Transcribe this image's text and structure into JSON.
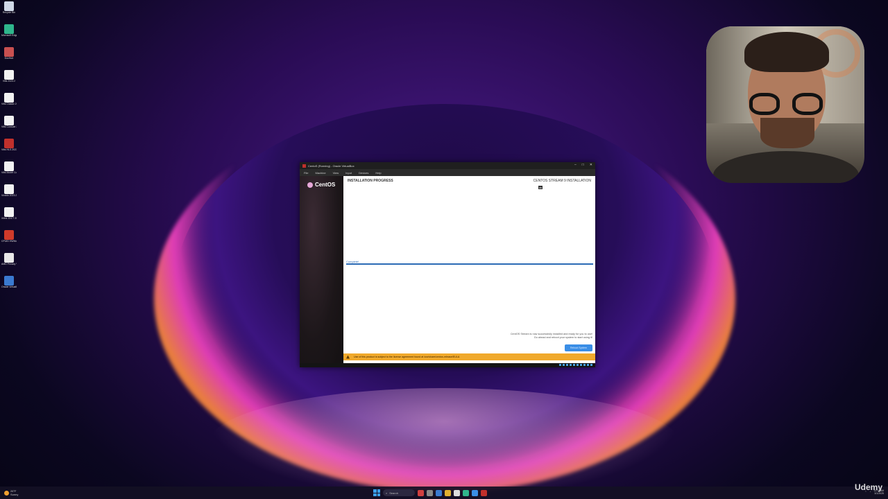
{
  "desktop": {
    "icons": [
      {
        "label": "Recycle Bin",
        "icon": "recycle-bin-icon",
        "color": "#cfd8e6"
      },
      {
        "label": "Microsoft Edge",
        "icon": "edge-icon",
        "color": "#2fb58c"
      },
      {
        "label": "DocHub",
        "icon": "app-icon",
        "color": "#c85050"
      },
      {
        "label": "Vitis 2023.2",
        "icon": "xilinx-icon",
        "color": "#f2f2f2"
      },
      {
        "label": "Vitis Classic 2023.2",
        "icon": "xilinx-icon",
        "color": "#f2f2f2"
      },
      {
        "label": "Vitis Console 2023.2",
        "icon": "xilinx-icon",
        "color": "#f2f2f2"
      },
      {
        "label": "Vitis HLS 2023.2",
        "icon": "app-icon",
        "color": "#c0302c"
      },
      {
        "label": "Vitis Model Composer",
        "icon": "xilinx-icon",
        "color": "#f2f2f2"
      },
      {
        "label": "Vivado 2023.2",
        "icon": "xilinx-icon",
        "color": "#f2f2f2"
      },
      {
        "label": "Xilinx JDCT 2023.2",
        "icon": "xilinx-icon",
        "color": "#f2f2f2"
      },
      {
        "label": "CPUID HWMonitor",
        "icon": "hwmonitor-icon",
        "color": "#d03a2a"
      },
      {
        "label": "AMD Privacy View",
        "icon": "amd-icon",
        "color": "#e8e8e8"
      },
      {
        "label": "Oracle VirtualBox",
        "icon": "virtualbox-icon",
        "color": "#3a7ad0"
      }
    ]
  },
  "vm_window": {
    "title": "CentoS (Running) - Oracle VirtualBox",
    "menu": [
      "File",
      "Machine",
      "View",
      "Input",
      "Devices",
      "Help"
    ],
    "controls": [
      "–",
      "□",
      "✕"
    ]
  },
  "installer": {
    "brand": "CentOS",
    "section_title": "INSTALLATION PROGRESS",
    "product_title": "CENTOS STREAM 9 INSTALLATION",
    "keyboard": "us",
    "progress_label": "Complete!",
    "progress_fraction": 1.0,
    "done_line1": "CentOS Stream is now successfully installed and ready for you to use!",
    "done_line2": "Go ahead and reboot your system to start using it!",
    "reboot_button": "Reboot System",
    "eula": "Use of this product is subject to the license agreement found at /usr/share/centos-release/EULA"
  },
  "taskbar": {
    "weather_temp": "26°F",
    "weather_desc": "Sunny",
    "search": "Search",
    "time": "11:17 AM",
    "date": "3/1/2025"
  },
  "watermark": "Udemy",
  "colors": {
    "accent": "#3a8ee6",
    "eula_bar": "#f0a92c",
    "progress": "#2a6ab5"
  }
}
